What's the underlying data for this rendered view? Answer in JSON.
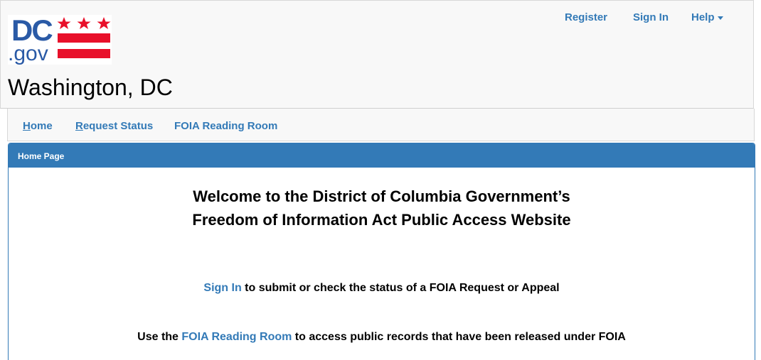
{
  "header": {
    "logo_text_dc": "DC",
    "logo_text_gov": ".gov",
    "site_title": "Washington, DC",
    "top_links": {
      "register": "Register",
      "sign_in": "Sign In",
      "help": "Help"
    }
  },
  "nav": {
    "home_first": "H",
    "home_rest": "ome",
    "request_first": "R",
    "request_rest": "equest Status",
    "reading_room": "FOIA Reading Room"
  },
  "panel": {
    "heading": "Home Page",
    "welcome_line1": "Welcome to the District of Columbia Government’s",
    "welcome_line2": "Freedom of Information Act Public Access Website",
    "signin_link": "Sign In",
    "signin_rest": " to submit or check the status of a FOIA Request or Appeal",
    "use_the": "Use the ",
    "reading_link": "FOIA Reading Room",
    "reading_rest": " to access public records that have been released under FOIA"
  },
  "colors": {
    "link_blue": "#337ab7",
    "logo_blue": "#2a5aa6",
    "flag_red": "#e8102a"
  },
  "icons": [
    "dc-flag-logo",
    "chevron-down-icon"
  ]
}
